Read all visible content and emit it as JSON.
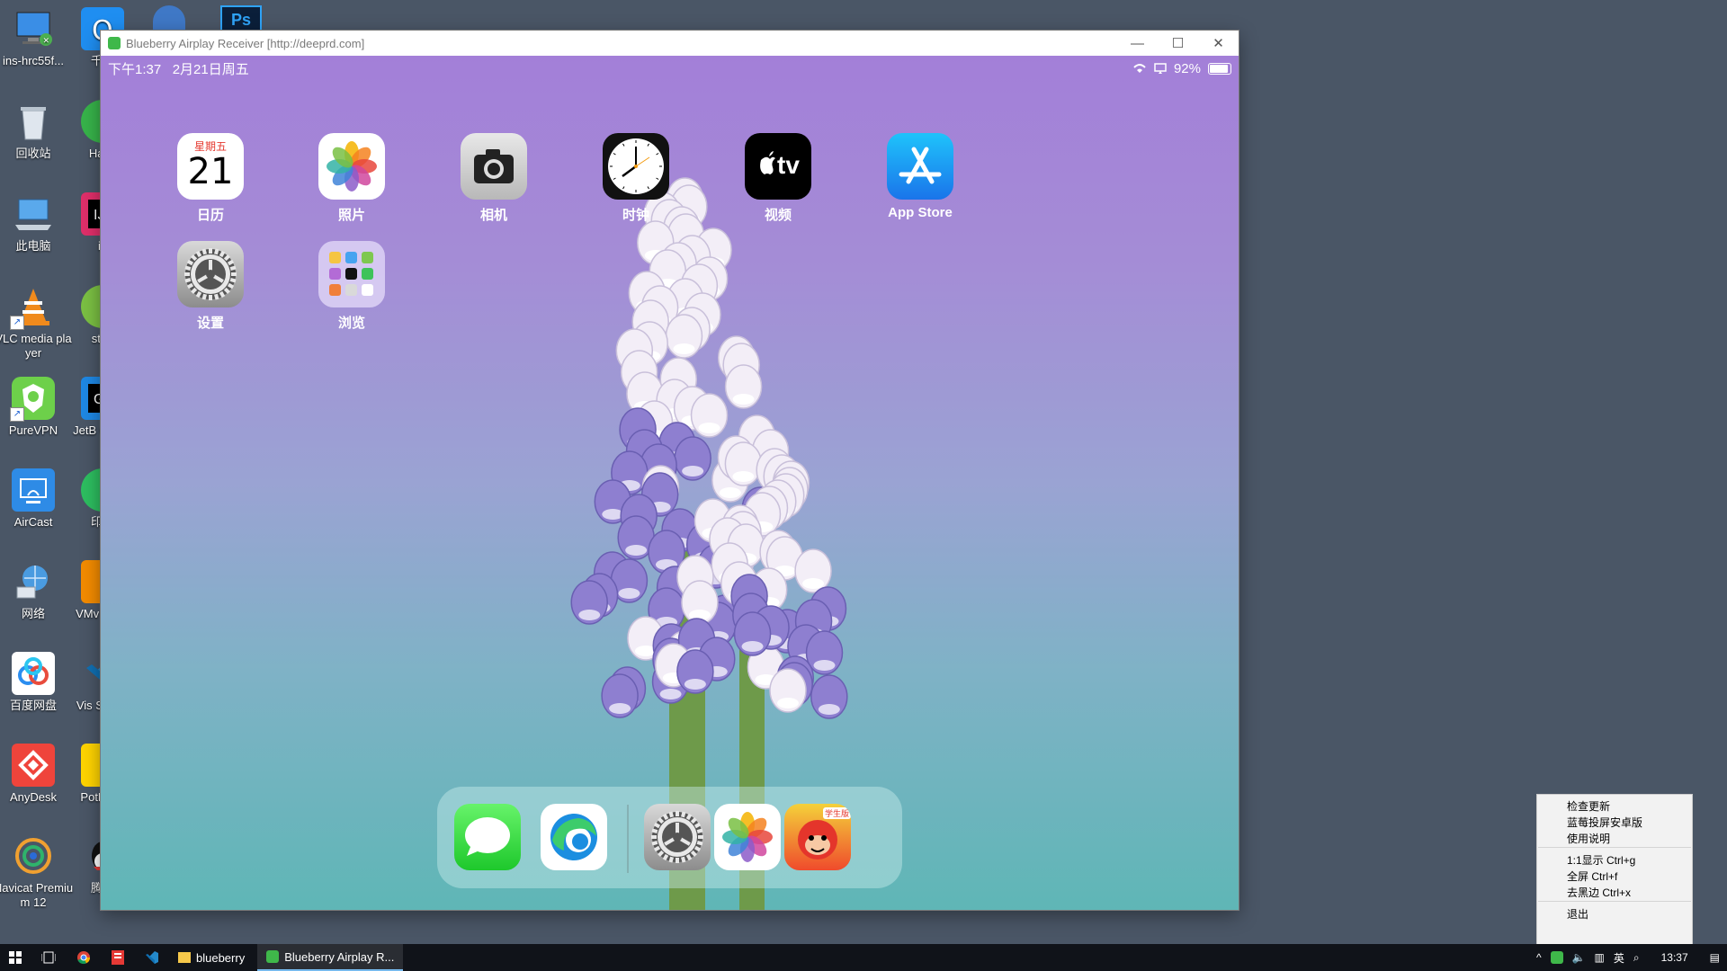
{
  "desktop": {
    "col1": [
      {
        "label": "ins-hrc55f...",
        "icon": "computer-icon"
      },
      {
        "label": "回收站",
        "icon": "recycle-bin-icon"
      },
      {
        "label": "此电脑",
        "icon": "this-pc-icon"
      },
      {
        "label": "VLC media player",
        "icon": "vlc-icon"
      },
      {
        "label": "PureVPN",
        "icon": "purevpn-icon"
      },
      {
        "label": "AirCast",
        "icon": "aircast-icon"
      },
      {
        "label": "网络",
        "icon": "network-icon"
      },
      {
        "label": "百度网盘",
        "icon": "baidu-netdisk-icon"
      },
      {
        "label": "AnyDesk",
        "icon": "anydesk-icon"
      },
      {
        "label": "Navicat Premium 12",
        "icon": "navicat-icon"
      }
    ],
    "col2": [
      {
        "label": "千牛",
        "icon": "qianniu-icon"
      },
      {
        "label": "Hash",
        "icon": "hash-icon"
      },
      {
        "label": "id",
        "icon": "idea-icon"
      },
      {
        "label": "stud",
        "icon": "studio-icon"
      },
      {
        "label": "JetB GoLar",
        "icon": "goland-icon"
      },
      {
        "label": "印象",
        "icon": "evernote-icon"
      },
      {
        "label": "VMv Work",
        "icon": "vmware-icon"
      },
      {
        "label": "Vis Studio",
        "icon": "vscode-icon"
      },
      {
        "label": "PotPla b",
        "icon": "potplayer-icon"
      },
      {
        "label": "腾讯",
        "icon": "qq-icon"
      }
    ]
  },
  "window": {
    "title": "Blueberry Airplay Receiver [http://deeprd.com]",
    "minimize": "—",
    "maximize": "☐",
    "close": "✕"
  },
  "ipad": {
    "status": {
      "time": "下午1:37",
      "date": "2月21日周五",
      "battery": "92%",
      "battery_level": 0.92
    },
    "apps": [
      {
        "label": "日历",
        "icon": "calendar-icon",
        "weekday": "星期五",
        "day": "21"
      },
      {
        "label": "照片",
        "icon": "photos-icon"
      },
      {
        "label": "相机",
        "icon": "camera-icon"
      },
      {
        "label": "时钟",
        "icon": "clock-icon"
      },
      {
        "label": "视频",
        "icon": "appletv-icon",
        "tv_text": "tv"
      },
      {
        "label": "App Store",
        "icon": "appstore-icon"
      },
      {
        "label": "设置",
        "icon": "settings-icon"
      },
      {
        "label": "浏览",
        "icon": "folder-icon"
      }
    ],
    "dock": [
      {
        "icon": "messages-icon"
      },
      {
        "icon": "edge-icon"
      },
      {
        "icon": "settings-icon"
      },
      {
        "icon": "photos-icon"
      },
      {
        "icon": "monkey-app-icon",
        "badge": "学生版"
      }
    ]
  },
  "context_menu": {
    "items": [
      "检查更新",
      "蓝莓投屏安卓版",
      "使用说明",
      "1:1显示 Ctrl+g",
      "全屏 Ctrl+f",
      "去黑边 Ctrl+x",
      "退出"
    ]
  },
  "taskbar": {
    "tasks": [
      {
        "label": "blueberry",
        "icon": "folder-icon"
      },
      {
        "label": "Blueberry Airplay R...",
        "icon": "blueberry-icon"
      }
    ],
    "tray": {
      "ime": "英",
      "time": "13:37"
    }
  }
}
